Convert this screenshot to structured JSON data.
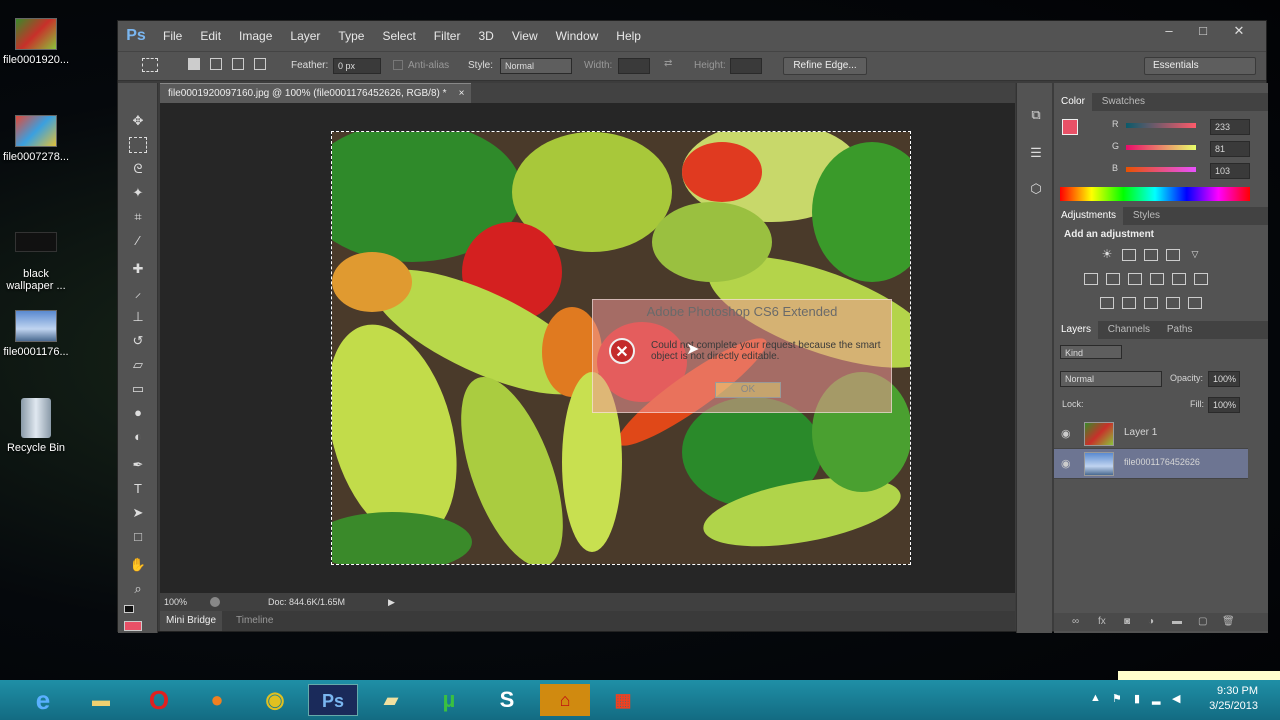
{
  "desktop": {
    "icons": [
      {
        "label": "file0001920..."
      },
      {
        "label": "file0007278..."
      },
      {
        "label": "black\nwallpaper ..."
      },
      {
        "label": "file0001176..."
      },
      {
        "label": "Recycle Bin"
      }
    ]
  },
  "app": {
    "logo": "Ps",
    "menu": [
      "File",
      "Edit",
      "Image",
      "Layer",
      "Type",
      "Select",
      "Filter",
      "3D",
      "View",
      "Window",
      "Help"
    ],
    "window_controls": {
      "minimize": "–",
      "maximize": "□",
      "close": "✕"
    }
  },
  "options_bar": {
    "feather_label": "Feather:",
    "feather_value": "0 px",
    "antialias_label": "Anti-alias",
    "style_label": "Style:",
    "style_value": "Normal",
    "width_label": "Width:",
    "height_label": "Height:",
    "refine_edge": "Refine Edge...",
    "workspace": "Essentials"
  },
  "document": {
    "tab_title": "file0001920097160.jpg @ 100% (file0001176452626, RGB/8) *",
    "zoom": "100%",
    "doc_info": "Doc: 844.6K/1.65M"
  },
  "bottom_tabs": [
    "Mini Bridge",
    "Timeline"
  ],
  "color_panel": {
    "tabs": [
      "Color",
      "Swatches"
    ],
    "r_label": "R",
    "r_value": "233",
    "g_label": "G",
    "g_value": "81",
    "b_label": "B",
    "b_value": "103",
    "foreground": "#e95167"
  },
  "adjustments_panel": {
    "tabs": [
      "Adjustments",
      "Styles"
    ],
    "heading": "Add an adjustment"
  },
  "layers_panel": {
    "tabs": [
      "Layers",
      "Channels",
      "Paths"
    ],
    "kind": "Kind",
    "blend_mode": "Normal",
    "opacity_label": "Opacity:",
    "opacity_value": "100%",
    "lock_label": "Lock:",
    "fill_label": "Fill:",
    "fill_value": "100%",
    "layers": [
      {
        "name": "Layer 1",
        "selected": false
      },
      {
        "name": "file0001176452626",
        "selected": true
      }
    ]
  },
  "dialog": {
    "title": "Adobe Photoshop CS6 Extended",
    "message": "Could not complete your request because the smart object is not directly editable.",
    "ok": "OK"
  },
  "taskbar": {
    "apps": [
      "ie-icon",
      "folder-icon",
      "opera-icon",
      "firefox-icon",
      "chrome-icon",
      "photoshop-icon",
      "explorer-icon",
      "utorrent-icon",
      "skype-icon",
      "adobe-icon",
      "office-icon"
    ],
    "ps_label": "Ps",
    "skype_label": "S",
    "time": "9:30 PM",
    "date": "3/25/2013"
  }
}
